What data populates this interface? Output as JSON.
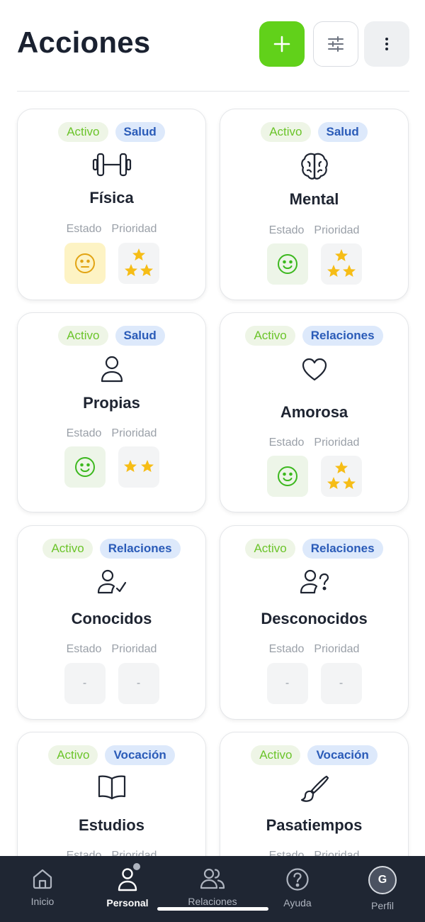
{
  "header": {
    "title": "Acciones",
    "add_icon": "plus-icon",
    "filter_icon": "sliders-icon",
    "more_icon": "more-vertical-icon"
  },
  "common": {
    "estado_label": "Estado",
    "prioridad_label": "Prioridad",
    "empty_value": "-"
  },
  "colors": {
    "accent": "#61d11a",
    "active_text": "#6bc42a",
    "category_text": "#2a5bb8",
    "nav_bg": "#1f2633",
    "star": "#f6bd16"
  },
  "cards": [
    {
      "status": "Activo",
      "category": "Salud",
      "name": "Física",
      "icon": "dumbbell-icon",
      "estado": "neutral-face-icon",
      "stars": 3
    },
    {
      "status": "Activo",
      "category": "Salud",
      "name": "Mental",
      "icon": "brain-icon",
      "estado": "smile-face-icon",
      "stars": 3
    },
    {
      "status": "Activo",
      "category": "Salud",
      "name": "Propias",
      "icon": "user-icon",
      "estado": "smile-face-icon",
      "stars": 2
    },
    {
      "status": "Activo",
      "category": "Relaciones",
      "name": "Amorosa",
      "icon": "heart-icon",
      "estado": "smile-face-icon",
      "stars": 3
    },
    {
      "status": "Activo",
      "category": "Relaciones",
      "name": "Conocidos",
      "icon": "user-check-icon",
      "estado": null,
      "stars": 0
    },
    {
      "status": "Activo",
      "category": "Relaciones",
      "name": "Desconocidos",
      "icon": "user-question-icon",
      "estado": null,
      "stars": 0
    },
    {
      "status": "Activo",
      "category": "Vocación",
      "name": "Estudios",
      "icon": "book-icon"
    },
    {
      "status": "Activo",
      "category": "Vocación",
      "name": "Pasatiempos",
      "icon": "brush-icon"
    }
  ],
  "nav": [
    {
      "label": "Inicio",
      "icon": "home-icon"
    },
    {
      "label": "Personal",
      "icon": "person-icon",
      "selected": true
    },
    {
      "label": "Relaciones",
      "icon": "users-icon"
    },
    {
      "label": "Ayuda",
      "icon": "help-circle-icon"
    },
    {
      "label": "Perfil",
      "icon": "avatar",
      "avatar_letter": "G"
    }
  ]
}
